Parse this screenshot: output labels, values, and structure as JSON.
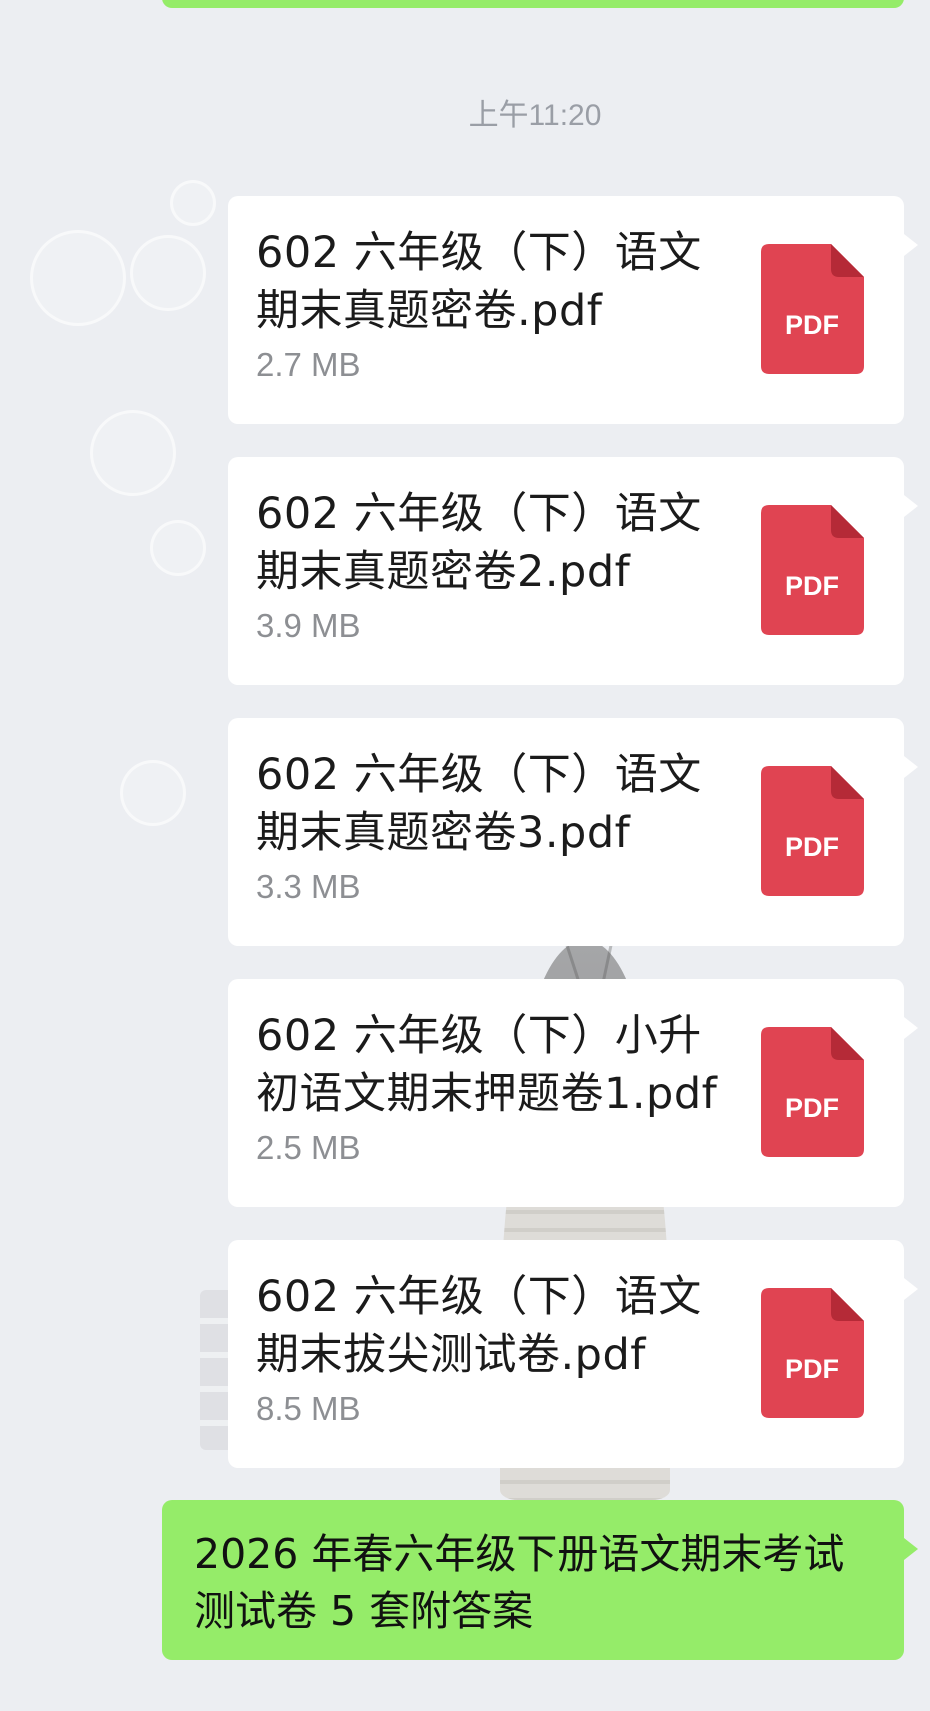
{
  "chat": {
    "timestamp": "上午11:20",
    "files": [
      {
        "name": "602 六年级（下）语文期末真题密卷.pdf",
        "size": "2.7 MB",
        "type": "PDF"
      },
      {
        "name": "602 六年级（下）语文期末真题密卷2.pdf",
        "size": "3.9 MB",
        "type": "PDF"
      },
      {
        "name": "602 六年级（下）语文期末真题密卷3.pdf",
        "size": "3.3 MB",
        "type": "PDF"
      },
      {
        "name": "602 六年级（下）小升初语文期末押题卷1.pdf",
        "size": "2.5 MB",
        "type": "PDF"
      },
      {
        "name": "602 六年级（下）语文期末拔尖测试卷.pdf",
        "size": "8.5 MB",
        "type": "PDF"
      }
    ],
    "text_message": "2026 年春六年级下册语文期末考试测试卷 5 套附答案"
  },
  "colors": {
    "background": "#eceef2",
    "bubble_green": "#95ec69",
    "pdf_red": "#e04452",
    "card_white": "#ffffff"
  },
  "icons": {
    "pdf": "pdf-file-icon"
  }
}
